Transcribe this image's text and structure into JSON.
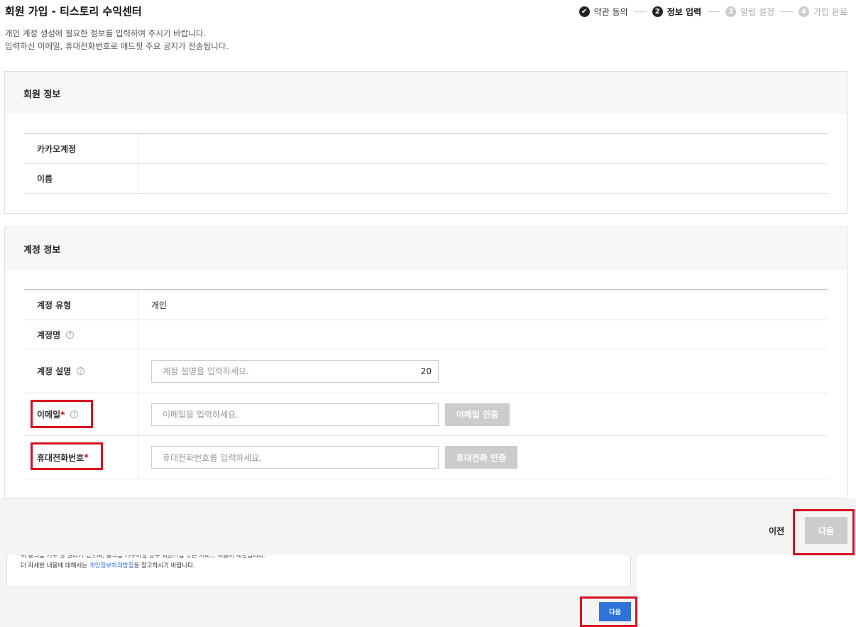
{
  "header": {
    "title": "회원 가입 - 티스토리 수익센터",
    "description_line1": "개인 계정 생성에 필요한 정보를 입력하여 주시기 바랍니다.",
    "description_line2": "입력하신 이메일, 휴대전화번호로 애드핏 주요 공지가 전송됩니다."
  },
  "steps": [
    {
      "num": "✔",
      "label": "약관 동의",
      "state": "done"
    },
    {
      "num": "2",
      "label": "정보 입력",
      "state": "current"
    },
    {
      "num": "3",
      "label": "알림 설정",
      "state": "todo"
    },
    {
      "num": "4",
      "label": "가입 완료",
      "state": "todo"
    }
  ],
  "member_section": {
    "title": "회원 정보",
    "rows": [
      {
        "label": "카카오계정",
        "value": ""
      },
      {
        "label": "이름",
        "value": ""
      }
    ]
  },
  "account_section": {
    "title": "계정 정보",
    "type_label": "계정 유형",
    "type_value": "개인",
    "name_label": "계정명",
    "desc_label": "계정 설명",
    "desc_placeholder": "계정 설명을 입력하세요.",
    "desc_count": "20",
    "email_label": "이메일",
    "email_placeholder": "이메일을 입력하세요.",
    "email_button": "이메일 인증",
    "phone_label": "휴대전화번호",
    "phone_placeholder": "휴대전화번호를 입력하세요.",
    "phone_button": "휴대전화 인증",
    "required_mark": "*",
    "help_glyph": "?"
  },
  "footer": {
    "prev_label": "이전",
    "next_label": "다음"
  },
  "lower_notice": {
    "line1": "위 동의를 거부 할 권리가 있으며, 동의를 거부하실 경우 회원가입 또는 서비스 이용이 제한됩니다.",
    "line2_prefix": "더 자세한 내용에 대해서는 ",
    "line2_link": "개인정보처리방침",
    "line2_suffix": "을 참고하시기 바랍니다.",
    "next_label": "다음"
  },
  "colors": {
    "highlight": "#d8101e",
    "link": "#2b6bd6",
    "primary_button": "#2f73d9",
    "disabled_button": "#cccccc"
  }
}
